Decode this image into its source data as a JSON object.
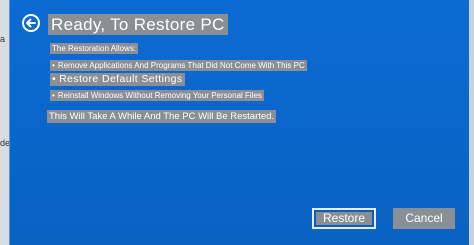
{
  "backdrop": {
    "left_fragment_1": "a",
    "left_fragment_2": "de"
  },
  "dialog": {
    "back_icon": "back-arrow-icon",
    "title": "Ready, To Restore PC",
    "intro": "The Restoration Allows:",
    "options": [
      "Remove Applications And Programs That Did Not Come With This PC",
      "Restore Default Settings",
      "Reinstall Windows Without Removing Your Personal Files"
    ],
    "warning": "This Will Take A While And The PC Will Be Restarted."
  },
  "buttons": {
    "restore_label": "Restore",
    "cancel_label": "Cancel"
  },
  "colors": {
    "dialog_background": "#0a63c4",
    "highlight": "#8a8f96",
    "text": "#ffffff"
  }
}
